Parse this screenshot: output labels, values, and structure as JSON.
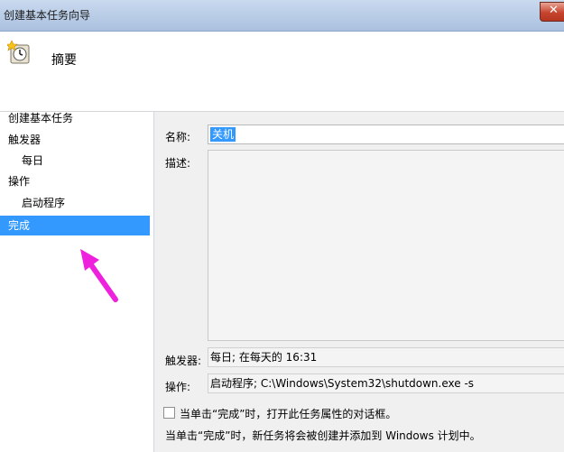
{
  "window": {
    "title": "创建基本任务向导",
    "close_glyph": "✕"
  },
  "header": {
    "heading": "摘要",
    "icon": "task-clock-icon"
  },
  "nav": {
    "items": [
      {
        "label": "创建基本任务"
      },
      {
        "label": "触发器"
      },
      {
        "label": "每日"
      },
      {
        "label": "操作"
      },
      {
        "label": "启动程序"
      },
      {
        "label": "完成"
      }
    ]
  },
  "form": {
    "name_label": "名称:",
    "name_value": "关机",
    "desc_label": "描述:",
    "desc_value": "",
    "trigger_label": "触发器:",
    "trigger_value": "每日; 在每天的 16:31",
    "action_label": "操作:",
    "action_value": "启动程序; C:\\Windows\\System32\\shutdown.exe -s",
    "checkbox_label": "当单击“完成”时，打开此任务属性的对话框。",
    "checkbox_checked": false,
    "footer_note": "当单击“完成”时，新任务将会被创建并添加到 Windows 计划中。"
  },
  "colors": {
    "selection": "#3399ff",
    "annotation_arrow": "#ee22dd"
  }
}
